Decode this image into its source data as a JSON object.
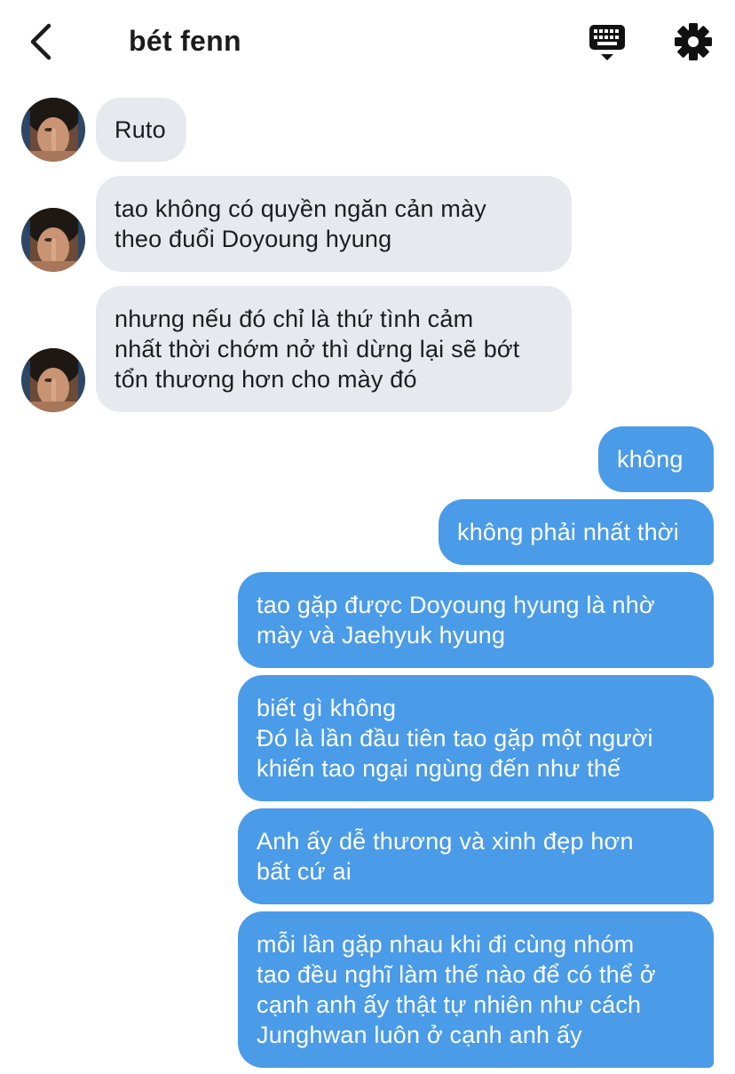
{
  "header": {
    "title": "bét fenn",
    "back_icon": "chevron-left-icon",
    "keyboard_icon": "keyboard-icon",
    "settings_icon": "gear-icon"
  },
  "colors": {
    "incoming_bubble": "#e6eaee",
    "outgoing_bubble": "#4a9be8",
    "text_dark": "#1c1c1e",
    "text_light": "#ffffff"
  },
  "messages": [
    {
      "direction": "incoming",
      "text": "Ruto"
    },
    {
      "direction": "incoming",
      "text": "tao không có quyền ngăn cản mày\ntheo đuổi Doyoung hyung"
    },
    {
      "direction": "incoming",
      "text": "nhưng nếu đó chỉ là thứ tình cảm\nnhất thời chớm nở thì dừng lại sẽ bớt\ntổn thương hơn cho mày đó"
    },
    {
      "direction": "outgoing",
      "text": "không"
    },
    {
      "direction": "outgoing",
      "text": "không phải nhất thời"
    },
    {
      "direction": "outgoing",
      "text": "tao gặp được Doyoung hyung là nhờ\nmày và Jaehyuk hyung"
    },
    {
      "direction": "outgoing",
      "text": "biết gì không\nĐó là lần đầu tiên tao gặp một người\nkhiến tao ngại ngùng đến như thế"
    },
    {
      "direction": "outgoing",
      "text": "Anh ấy dễ thương và xinh đẹp hơn\nbất cứ ai"
    },
    {
      "direction": "outgoing",
      "text": "mỗi lần gặp nhau khi đi cùng nhóm\ntao đều nghĩ làm thế nào để có thể ở\ncạnh anh ấy thật tự nhiên như cách\nJunghwan luôn ở cạnh anh ấy"
    }
  ]
}
